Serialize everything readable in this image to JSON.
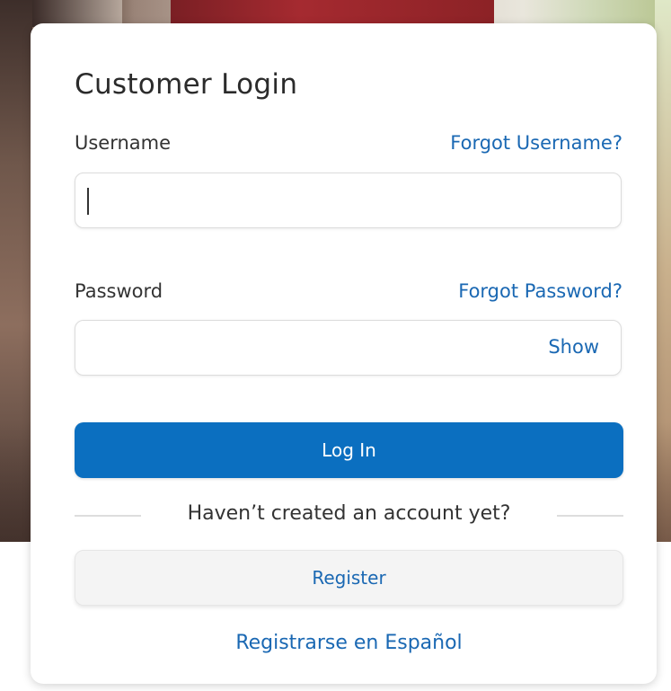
{
  "login": {
    "title": "Customer Login",
    "username": {
      "label": "Username",
      "forgot_link": "Forgot Username?",
      "value": ""
    },
    "password": {
      "label": "Password",
      "forgot_link": "Forgot Password?",
      "value": "",
      "show_toggle": "Show"
    },
    "login_button": "Log In",
    "divider_text": "Haven’t created an account yet?",
    "register_button": "Register",
    "spanish_register_link": "Registrarse en Español"
  },
  "colors": {
    "accent": "#0b6fc0",
    "link": "#1a68b3",
    "text": "#333333"
  }
}
